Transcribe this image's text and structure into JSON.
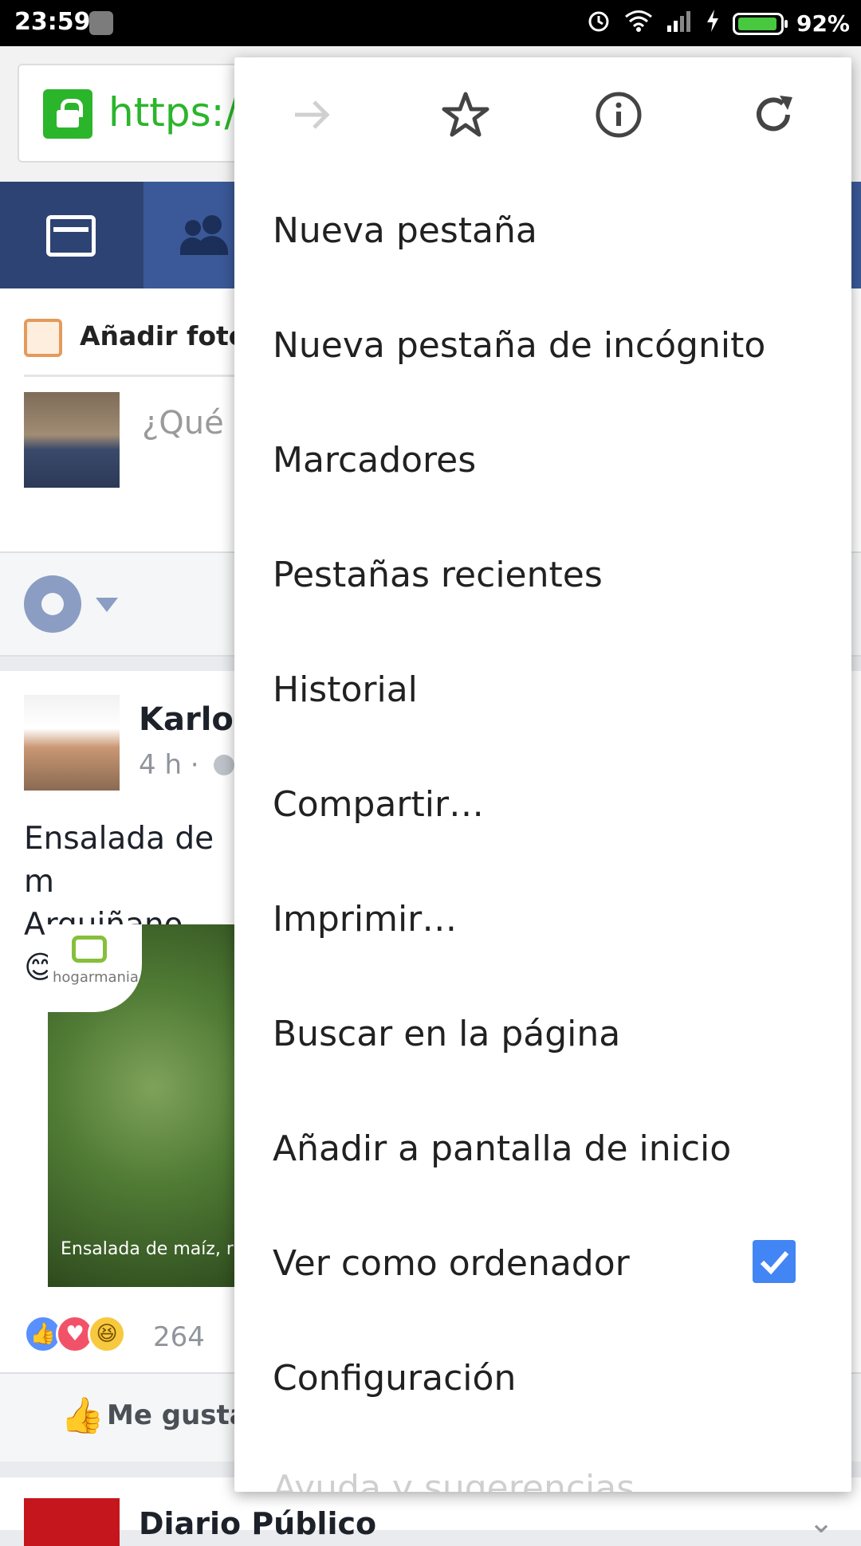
{
  "status_bar": {
    "time": "23:59",
    "battery_percent": "92%",
    "battery_level": 0.92,
    "battery_color": "#47c83e",
    "icons": [
      "app-icon",
      "alarm-icon",
      "wifi-icon",
      "signal-icon",
      "charging-icon",
      "battery-icon"
    ]
  },
  "browser": {
    "url_text": "https://",
    "accent_color": "#2bb52b"
  },
  "facebook": {
    "nav_color": "#3b5998",
    "add_photos": "Añadir fotos",
    "composer_placeholder": "¿Qué e",
    "post": {
      "author": "Karlos",
      "time": "4 h ·",
      "text": "Ensalada de m Arguiñano... 😊",
      "image_logo": "hogarmania",
      "image_caption": "Ensalada de maíz, r",
      "reaction_count": "264",
      "like_label": "Me gusta"
    },
    "next_post_author": "Diario Público"
  },
  "menu": {
    "icons": [
      "forward-arrow-icon",
      "star-icon",
      "info-icon",
      "reload-icon"
    ],
    "items": [
      "Nueva pestaña",
      "Nueva pestaña de incógnito",
      "Marcadores",
      "Pestañas recientes",
      "Historial",
      "Compartir…",
      "Imprimir…",
      "Buscar en la página",
      "Añadir a pantalla de inicio",
      "Ver como ordenador",
      "Configuración",
      "Ayuda y sugerencias"
    ],
    "desktop_view_checked": true,
    "checkbox_color": "#4285f4"
  }
}
